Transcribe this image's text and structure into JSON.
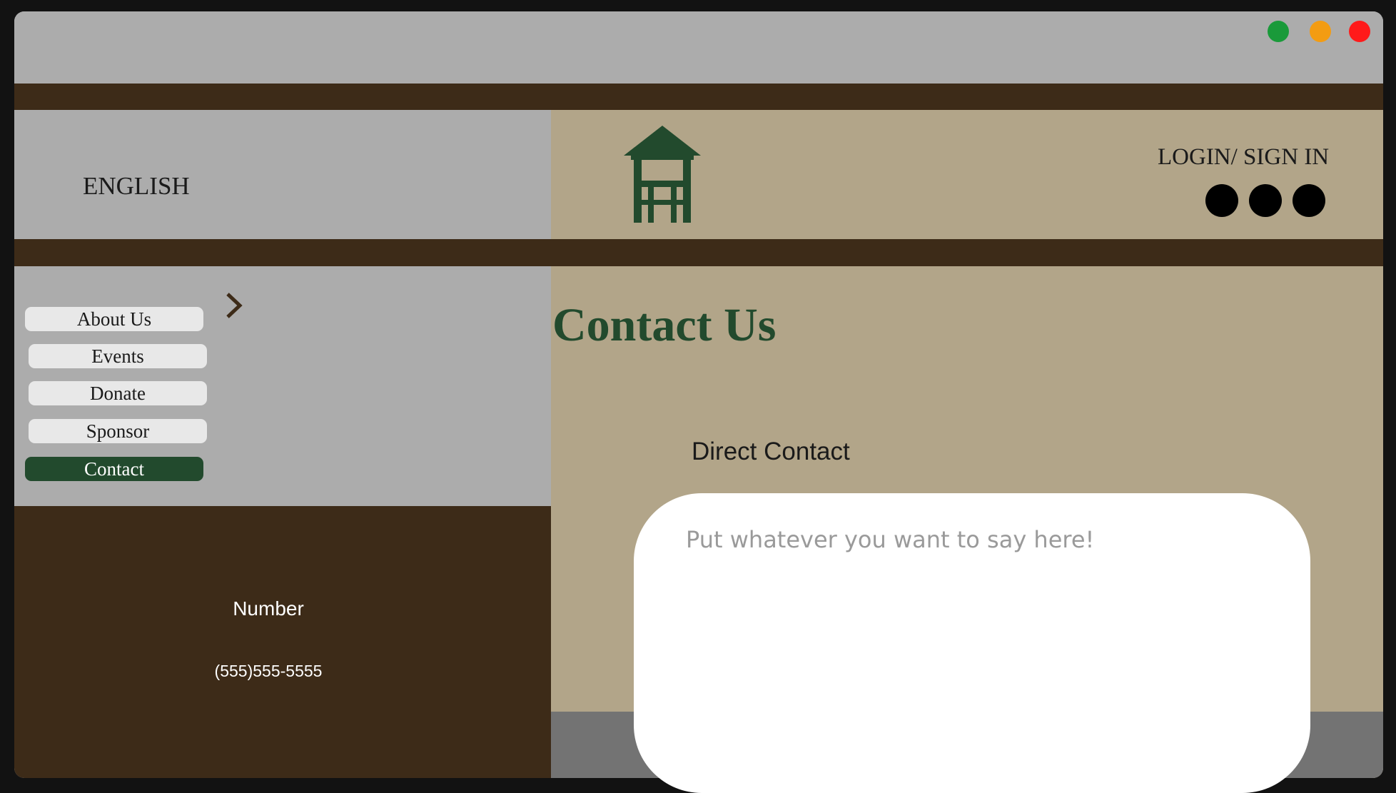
{
  "window": {
    "controls": [
      {
        "name": "maximize",
        "color": "#1a9a3a"
      },
      {
        "name": "minimize",
        "color": "#f39c12"
      },
      {
        "name": "close",
        "color": "#ff1a1a"
      }
    ]
  },
  "header": {
    "language": "ENGLISH",
    "login_label": "LOGIN/ SIGN IN",
    "logo_icon": "watchtower-icon",
    "social_icons": [
      "social-icon-1",
      "social-icon-2",
      "social-icon-3"
    ]
  },
  "sidebar": {
    "items": [
      {
        "label": "About Us",
        "active": false
      },
      {
        "label": "Events",
        "active": false
      },
      {
        "label": "Donate",
        "active": false
      },
      {
        "label": "Sponsor",
        "active": false
      },
      {
        "label": "Contact",
        "active": true
      }
    ],
    "expand_icon": "chevron-right-icon"
  },
  "contact_info": {
    "label": "Number",
    "value": "(555)555-5555"
  },
  "main": {
    "title": "Contact Us",
    "direct_contact_label": "Direct Contact",
    "message_placeholder": "Put whatever you want to say here!"
  },
  "colors": {
    "accent_green": "#224a2d",
    "dark_brown": "#3d2b18",
    "tan": "#b2a589",
    "gray": "#acacac"
  }
}
